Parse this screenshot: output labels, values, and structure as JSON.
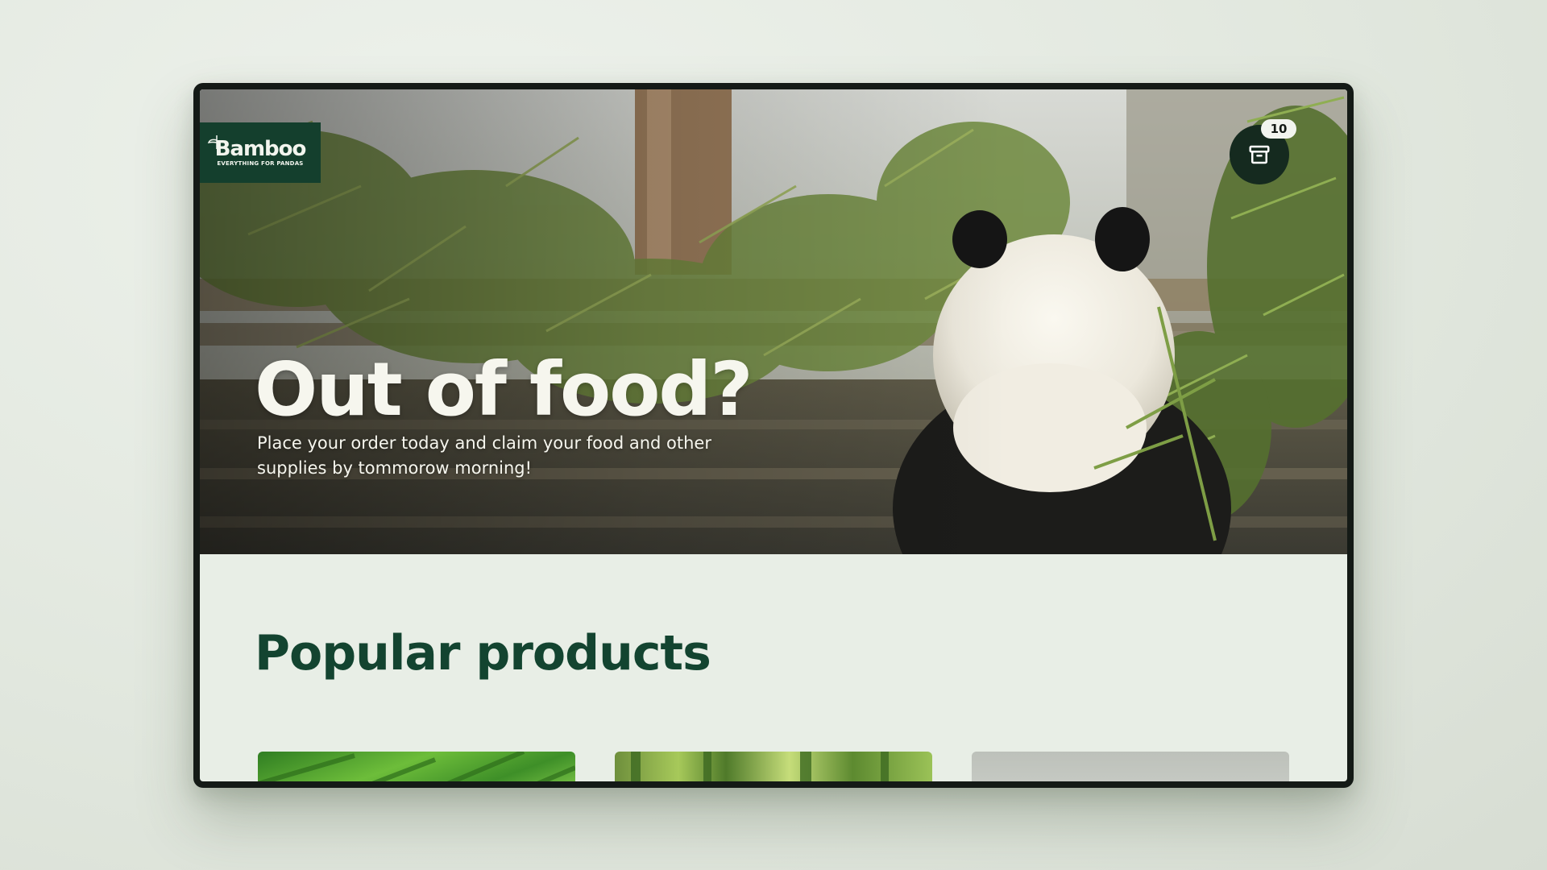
{
  "brand": {
    "name": "Bamboo",
    "tagline": "EVERYTHING FOR PANDAS",
    "primary_color": "#143f2d",
    "background_color": "#e8eee6"
  },
  "cart": {
    "count": "10",
    "icon": "archive-box-icon"
  },
  "hero": {
    "title": "Out of food?",
    "subtitle": "Place your order today and claim your food and other supplies by tommorow morning!",
    "image": "panda-eating-bamboo-photo"
  },
  "products": {
    "heading": "Popular products",
    "items": [
      {
        "image": "bamboo-leaves-photo"
      },
      {
        "image": "bamboo-stalks-photo"
      },
      {
        "image": "product-photo"
      }
    ]
  }
}
